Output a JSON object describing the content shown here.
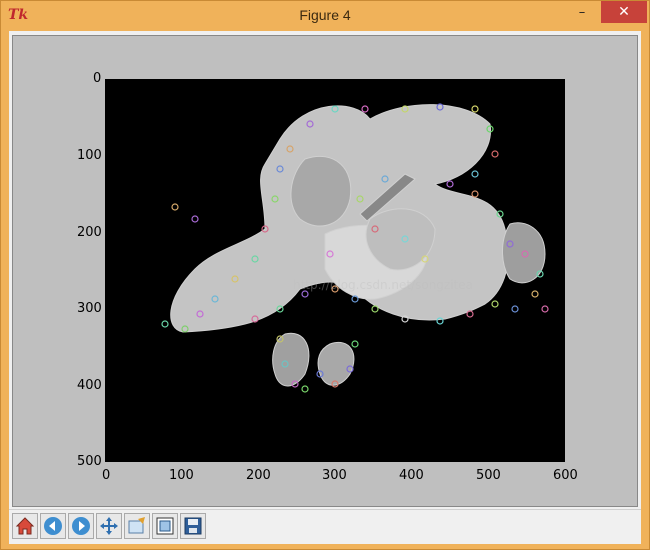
{
  "window": {
    "title": "Figure 4",
    "app_icon": "tk-logo",
    "app_icon_text": "Tk",
    "minimize_label": "–",
    "maximize_label": "□",
    "close_label": "✕"
  },
  "figure": {
    "x_ticks": [
      "0",
      "100",
      "200",
      "300",
      "400",
      "500",
      "600"
    ],
    "y_ticks": [
      "0",
      "100",
      "200",
      "300",
      "400",
      "500"
    ],
    "watermark": "http://blog.csdn.net/songzitea",
    "image_description_icon": "grayscale-leaf-image-with-keypoints"
  },
  "toolbar": {
    "buttons": [
      {
        "name": "home-button",
        "icon": "home-icon"
      },
      {
        "name": "back-button",
        "icon": "back-arrow-icon"
      },
      {
        "name": "forward-button",
        "icon": "forward-arrow-icon"
      },
      {
        "name": "pan-button",
        "icon": "move-arrows-icon"
      },
      {
        "name": "zoom-button",
        "icon": "zoom-rect-icon"
      },
      {
        "name": "configure-subplots-button",
        "icon": "subplots-icon"
      },
      {
        "name": "save-button",
        "icon": "save-disk-icon"
      }
    ]
  },
  "colors": {
    "titlebar": "#f0b25a",
    "close_button": "#c7423a",
    "figure_bg": "#bfbfbf",
    "plot_bg": "#000000"
  }
}
